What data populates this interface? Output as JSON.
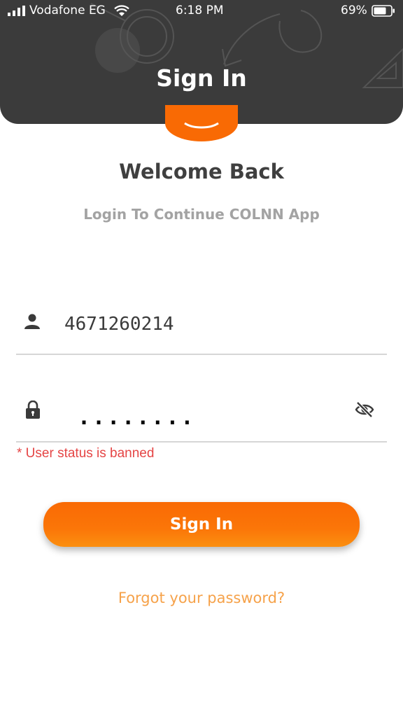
{
  "status_bar": {
    "carrier": "Vodafone EG",
    "time": "6:18 PM",
    "battery": "69%"
  },
  "header": {
    "title": "Sign In"
  },
  "welcome": {
    "title": "Welcome Back",
    "subtitle": "Login To Continue COLNN App"
  },
  "form": {
    "username_value": "4671260214",
    "password_mask": "........",
    "error": "* User status is banned",
    "icons": {
      "user": "person-icon",
      "password": "lock-icon",
      "toggle": "eye-off-icon"
    }
  },
  "actions": {
    "signin_label": "Sign In",
    "forgot_label": "Forgot your password?"
  },
  "colors": {
    "header_bg": "#3b3b3b",
    "accent": "#f96a04",
    "error": "#e54545",
    "link": "#f6a24a"
  }
}
